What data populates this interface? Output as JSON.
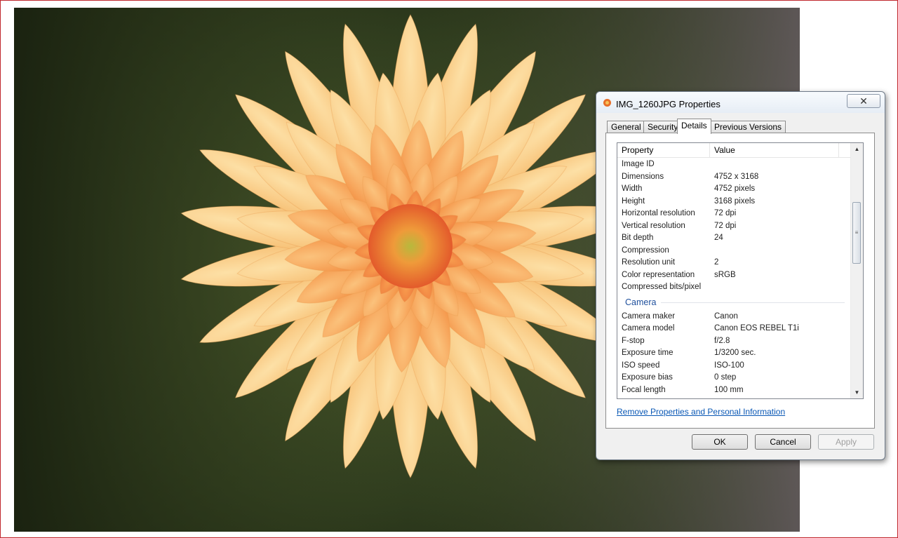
{
  "dialog": {
    "title": "IMG_1260JPG Properties",
    "close_glyph": "✕",
    "tabs": [
      {
        "label": "General"
      },
      {
        "label": "Security"
      },
      {
        "label": "Details"
      },
      {
        "label": "Previous Versions"
      }
    ],
    "active_tab": "Details",
    "columns": {
      "property": "Property",
      "value": "Value"
    },
    "image_rows": [
      {
        "property": "Image ID",
        "value": ""
      },
      {
        "property": "Dimensions",
        "value": "4752 x 3168"
      },
      {
        "property": "Width",
        "value": "4752 pixels"
      },
      {
        "property": "Height",
        "value": "3168 pixels"
      },
      {
        "property": "Horizontal resolution",
        "value": "72 dpi"
      },
      {
        "property": "Vertical resolution",
        "value": "72 dpi"
      },
      {
        "property": "Bit depth",
        "value": "24"
      },
      {
        "property": "Compression",
        "value": ""
      },
      {
        "property": "Resolution unit",
        "value": "2"
      },
      {
        "property": "Color representation",
        "value": "sRGB"
      },
      {
        "property": "Compressed bits/pixel",
        "value": ""
      }
    ],
    "camera_group": "Camera",
    "camera_rows": [
      {
        "property": "Camera maker",
        "value": "Canon"
      },
      {
        "property": "Camera model",
        "value": "Canon EOS REBEL T1i"
      },
      {
        "property": "F-stop",
        "value": "f/2.8"
      },
      {
        "property": "Exposure time",
        "value": "1/3200 sec."
      },
      {
        "property": "ISO speed",
        "value": "ISO-100"
      },
      {
        "property": "Exposure bias",
        "value": "0 step"
      },
      {
        "property": "Focal length",
        "value": "100 mm"
      }
    ],
    "remove_link": "Remove Properties and Personal Information",
    "buttons": {
      "ok": "OK",
      "cancel": "Cancel",
      "apply": "Apply"
    }
  },
  "colors": {
    "link": "#0a58b5",
    "group_heading": "#1e4f9c",
    "page_border": "#c0272d"
  },
  "icons": {
    "title": "picture-file-icon",
    "close": "close-icon",
    "scroll_up": "scroll-up-arrow-icon",
    "scroll_down": "scroll-down-arrow-icon"
  }
}
